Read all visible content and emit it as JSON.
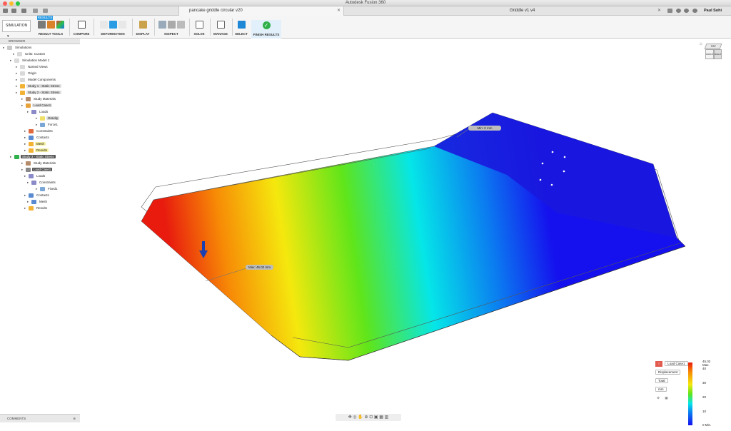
{
  "window": {
    "title": "Autodesk Fusion 360"
  },
  "tabs": [
    {
      "label": "pancake griddle circular v20",
      "active": true
    },
    {
      "label": "Griddle v1 v4",
      "active": false
    }
  ],
  "user": {
    "name": "Paul Sohi"
  },
  "toolbar": {
    "workspace": "SIMULATION",
    "context_tab": "RESULTS",
    "groups": [
      {
        "label": "RESULT TOOLS"
      },
      {
        "label": "COMPARE"
      },
      {
        "label": "DEFORMATION"
      },
      {
        "label": "DISPLAY"
      },
      {
        "label": "INSPECT"
      },
      {
        "label": "SOLVE"
      },
      {
        "label": "MANAGE"
      },
      {
        "label": "SELECT"
      },
      {
        "label": "FINISH RESULTS"
      }
    ]
  },
  "browser": {
    "header": "BROWSER",
    "items": [
      {
        "label": "Simulations"
      },
      {
        "label": "Units: Custom"
      },
      {
        "label": "Simulation Model 1"
      },
      {
        "label": "Named Views"
      },
      {
        "label": "Origin"
      },
      {
        "label": "Model Components"
      },
      {
        "label": "Study 1 - Static Stress"
      },
      {
        "label": "Study 2 - Static Stress"
      },
      {
        "label": "Study Materials"
      },
      {
        "label": "Load Case1"
      },
      {
        "label": "Loads"
      },
      {
        "label": "Gravity"
      },
      {
        "label": "Force1"
      },
      {
        "label": "Constraints"
      },
      {
        "label": "Contacts"
      },
      {
        "label": "Mesh"
      },
      {
        "label": "Results"
      },
      {
        "label": "Study 3 - Static Stress"
      },
      {
        "label": "Study Materials"
      },
      {
        "label": "Load Case1"
      },
      {
        "label": "Loads"
      },
      {
        "label": "Constraints"
      },
      {
        "label": "Fixed1"
      },
      {
        "label": "Contacts"
      },
      {
        "label": "Mesh"
      },
      {
        "label": "Results"
      }
    ]
  },
  "viewport": {
    "max_label": "Max: 45.02 mm",
    "min_label": "Min: 0 mm",
    "viewcube": {
      "top": "TOP",
      "front": "FRONT",
      "right": "RIGHT"
    }
  },
  "legend": {
    "load_case": "Load Case1",
    "result_type": "Displacement",
    "component": "Total",
    "unit": "mm",
    "ticks": [
      "45.02 Max.",
      "40",
      "30",
      "20",
      "10",
      "0 Min."
    ],
    "colors": {
      "max": "#e81b0e",
      "min": "#1511ee"
    }
  },
  "bottom": {
    "comments": "COMMENTS"
  }
}
